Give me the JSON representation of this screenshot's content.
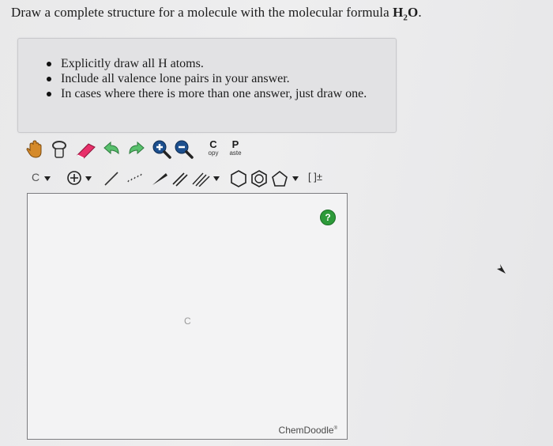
{
  "question": {
    "prefix": "Draw a complete structure for a molecule with the molecular formula ",
    "formula_H": "H",
    "formula_sub": "2",
    "formula_O": "O",
    "suffix": "."
  },
  "instructions": [
    "Explicitly draw all H atoms.",
    "Include all valence lone pairs in your answer.",
    "In cases where there is more than one answer, just draw one."
  ],
  "toolbar_top": {
    "copy_letter": "C",
    "copy_sub": "opy",
    "paste_letter": "P",
    "paste_sub": "aste"
  },
  "toolbar_bottom": {
    "element_label": "C",
    "charge_label": "[ ]±"
  },
  "canvas": {
    "help_label": "?",
    "atom_label": "C",
    "brand": "ChemDoodle",
    "brand_mark": "®"
  },
  "colors": {
    "help_green": "#2d9a3a",
    "eraser_pink": "#e8306a",
    "arrow_green": "#59c06d",
    "zoom_blue": "#1c4f8e"
  }
}
